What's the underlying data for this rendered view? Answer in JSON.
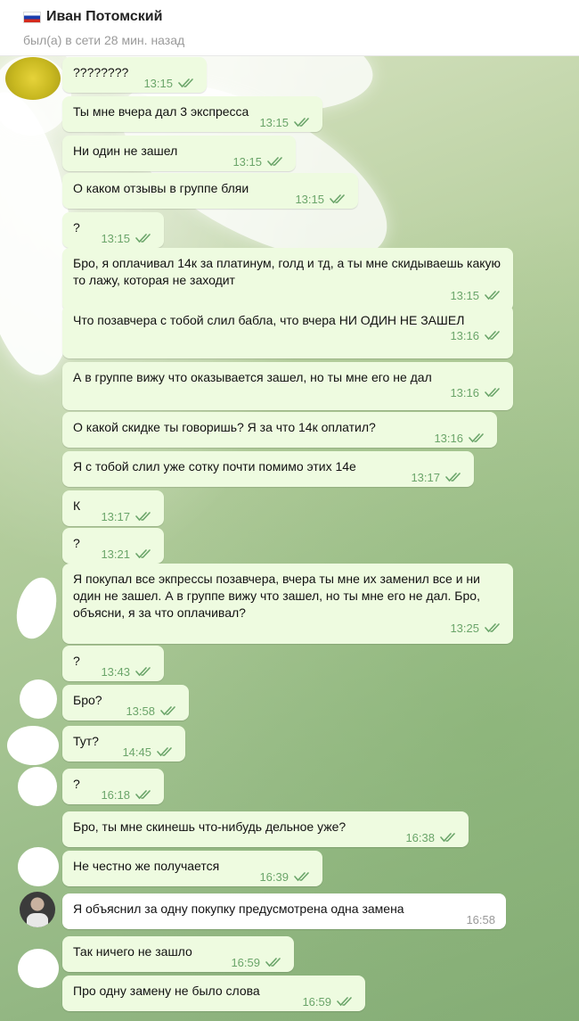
{
  "header": {
    "contact_name": "Иван Потомский",
    "status": "был(а) в сети 28 мин. назад",
    "flag_icon": "russia-flag-icon"
  },
  "colors": {
    "outgoing_bubble": "#eefbe0",
    "incoming_bubble": "#ffffff",
    "time_outgoing": "#6ba56a",
    "time_incoming": "#999999",
    "check_color": "#6ba56a"
  },
  "messages": [
    {
      "text": "????????",
      "time": "13:15",
      "read": true
    },
    {
      "text": "Ты мне вчера дал 3 экспресса",
      "time": "13:15",
      "read": true
    },
    {
      "text": "Ни один не зашел",
      "time": "13:15",
      "read": true
    },
    {
      "text": "О каком отзывы в группе бляи",
      "time": "13:15",
      "read": true
    },
    {
      "text": "?",
      "time": "13:15",
      "read": true
    },
    {
      "text": "Бро, я оплачивал 14к за платинум, голд и тд, а ты мне скидываешь какую то лажу, которая не заходит",
      "time": "13:15",
      "read": true
    },
    {
      "text": "Что позавчера с тобой слил бабла, что вчера НИ ОДИН НЕ ЗАШЕЛ",
      "time": "13:16",
      "read": true
    },
    {
      "text": "А в группе вижу что оказывается зашел, но ты мне его не дал",
      "time": "13:16",
      "read": true
    },
    {
      "text": "О какой скидке ты говоришь? Я за что 14к оплатил?",
      "time": "13:16",
      "read": true
    },
    {
      "text": "Я с тобой слил уже сотку почти помимо этих 14е",
      "time": "13:17",
      "read": true
    },
    {
      "text": "К",
      "time": "13:17",
      "read": true
    },
    {
      "text": "?",
      "time": "13:21",
      "read": true
    },
    {
      "text": "Я покупал все экпрессы позавчера, вчера ты мне их заменил все и ни один не зашел. А в группе вижу что зашел, но ты мне его не дал. Бро, объясни, я за что оплачивал?",
      "time": "13:25",
      "read": true
    },
    {
      "text": "?",
      "time": "13:43",
      "read": true
    },
    {
      "text": "Бро?",
      "time": "13:58",
      "read": true
    },
    {
      "text": "Тут?",
      "time": "14:45",
      "read": true
    },
    {
      "text": "?",
      "time": "16:18",
      "read": true
    },
    {
      "text": "Бро, ты мне скинешь что-нибудь дельное уже?",
      "time": "16:38",
      "read": true
    },
    {
      "text": "Не честно же получается",
      "time": "16:39",
      "read": true
    },
    {
      "text": "Я объяснил за одну покупку предусмотрена одна замена",
      "time": "16:58",
      "read": false
    },
    {
      "text": "Так ничего не зашло",
      "time": "16:59",
      "read": true
    },
    {
      "text": "Про одну замену не было слова",
      "time": "16:59",
      "read": true
    }
  ]
}
